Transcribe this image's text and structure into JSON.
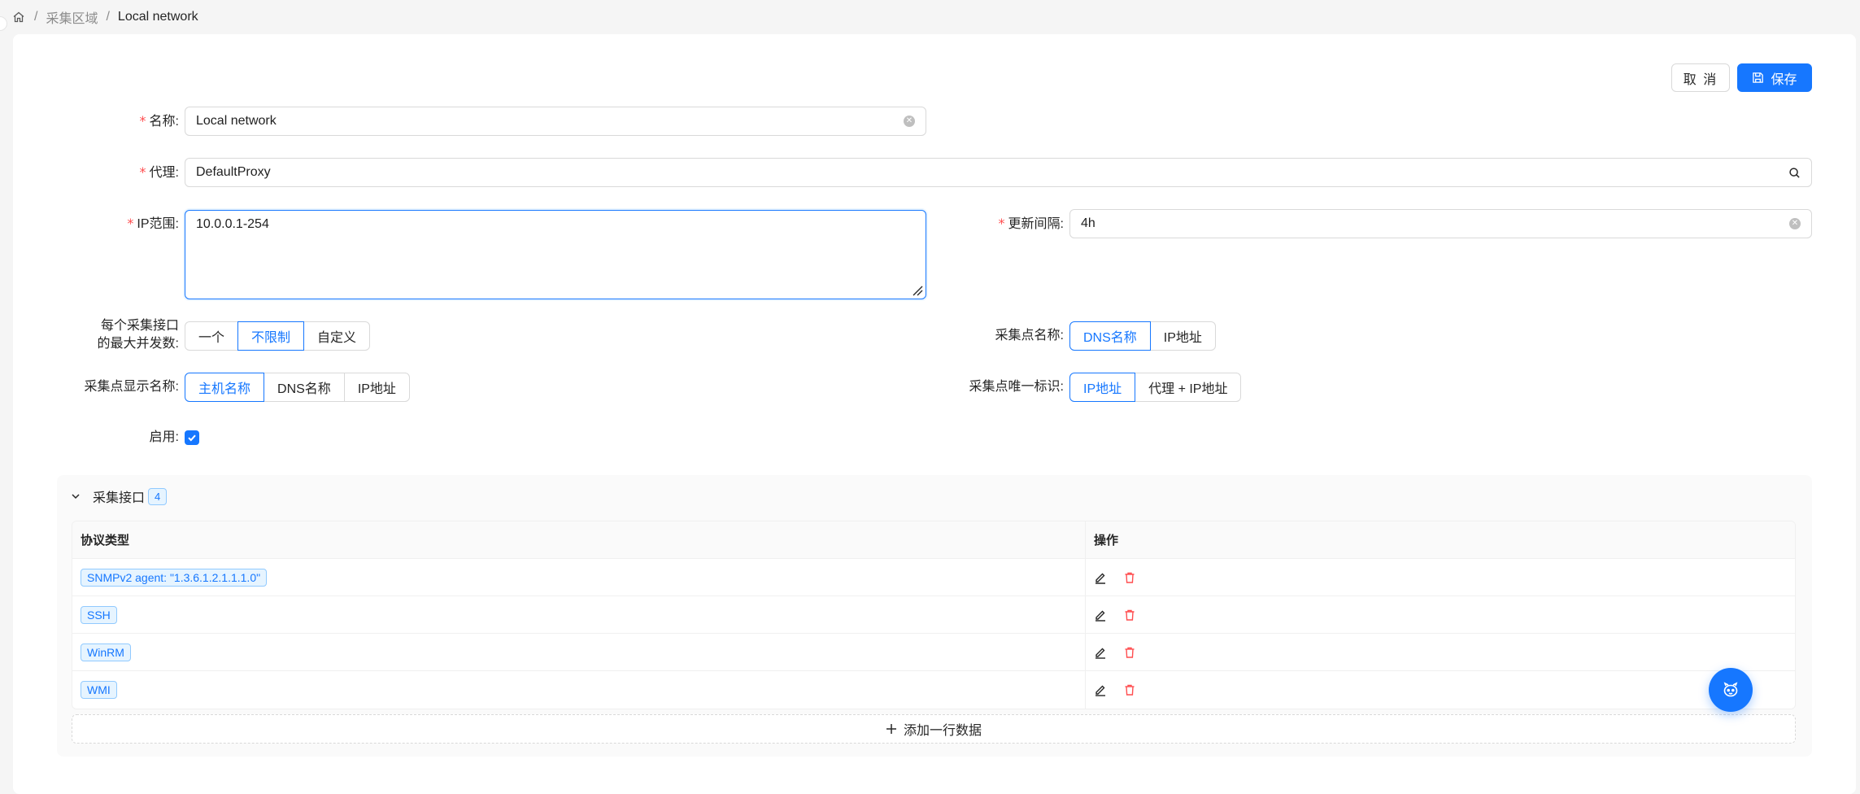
{
  "breadcrumb": {
    "level1": "采集区域",
    "current": "Local network",
    "separator": "/"
  },
  "toolbar": {
    "cancel_label": "取 消",
    "save_label": "保存"
  },
  "form": {
    "name": {
      "label": "名称",
      "value": "Local network"
    },
    "proxy": {
      "label": "代理",
      "value": "DefaultProxy"
    },
    "ip_range": {
      "label": "IP范围",
      "value": "10.0.0.1-254"
    },
    "update_interval": {
      "label": "更新间隔",
      "value": "4h"
    },
    "max_concurrency": {
      "label_line1": "每个采集接口",
      "label_line2": "的最大并发数",
      "options": [
        "一个",
        "不限制",
        "自定义"
      ],
      "selected": "不限制"
    },
    "collector_name": {
      "label": "采集点名称",
      "options": [
        "DNS名称",
        "IP地址"
      ],
      "selected": "DNS名称"
    },
    "display_name": {
      "label": "采集点显示名称",
      "options": [
        "主机名称",
        "DNS名称",
        "IP地址"
      ],
      "selected": "主机名称"
    },
    "unique_id": {
      "label": "采集点唯一标识",
      "options": [
        "IP地址",
        "代理 + IP地址"
      ],
      "selected": "IP地址"
    },
    "enabled": {
      "label": "启用",
      "checked": true
    }
  },
  "interfaces": {
    "title": "采集接口",
    "count": "4",
    "columns": [
      "协议类型",
      "操作"
    ],
    "rows": [
      "SNMPv2 agent: \"1.3.6.1.2.1.1.1.0\"",
      "SSH",
      "WinRM",
      "WMI"
    ],
    "add_label": "添加一行数据"
  },
  "colors": {
    "primary": "#1677ff",
    "danger": "#ff4d4f",
    "required": "#ff4d4f"
  },
  "icons": {
    "home": "home-icon",
    "save": "save-icon",
    "search": "search-icon",
    "edit": "edit-icon",
    "delete": "delete-icon",
    "collapse": "chevron-down-icon",
    "add": "plus-icon",
    "assistant": "robot-icon"
  }
}
